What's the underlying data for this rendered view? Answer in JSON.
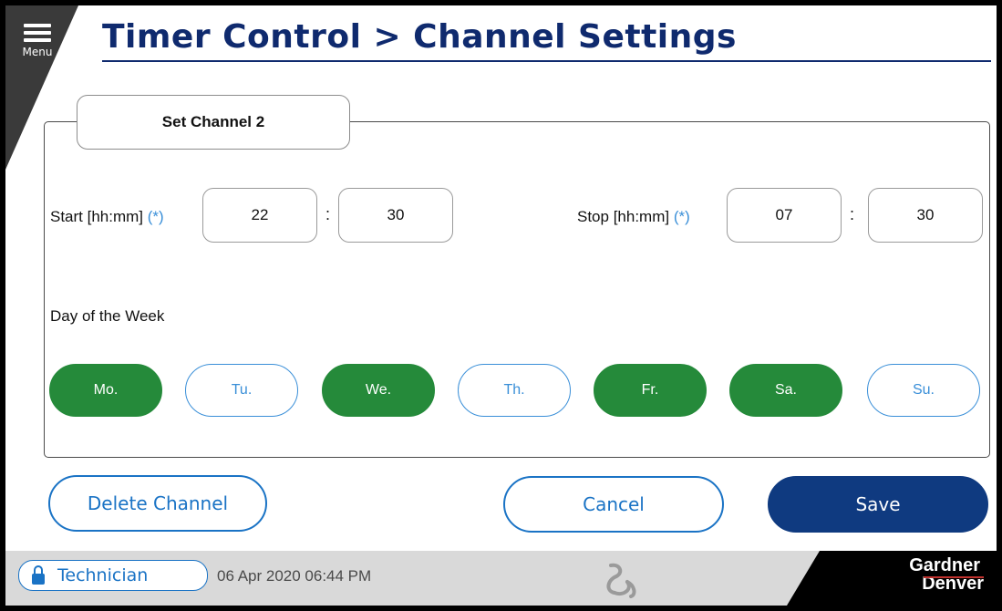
{
  "header": {
    "menu_label": "Menu",
    "title": "Timer Control > Channel Settings"
  },
  "panel": {
    "tab_label": "Set Channel 2",
    "start_label": "Start [hh:mm]",
    "stop_label": "Stop [hh:mm]",
    "required_marker": "(*)",
    "colon": ":",
    "start_hours": "22",
    "start_minutes": "30",
    "stop_hours": "07",
    "stop_minutes": "30",
    "days_label": "Day of the Week",
    "days": [
      {
        "label": "Mo.",
        "active": true
      },
      {
        "label": "Tu.",
        "active": false
      },
      {
        "label": "We.",
        "active": true
      },
      {
        "label": "Th.",
        "active": false
      },
      {
        "label": "Fr.",
        "active": true
      },
      {
        "label": "Sa.",
        "active": true
      },
      {
        "label": "Su.",
        "active": false
      }
    ]
  },
  "actions": {
    "delete_label": "Delete Channel",
    "cancel_label": "Cancel",
    "save_label": "Save"
  },
  "status_bar": {
    "role": "Technician",
    "datetime": "06 Apr 2020  06:44 PM",
    "brand_line1": "Gardner",
    "brand_line2": "Denver"
  },
  "colors": {
    "title": "#0f2a6e",
    "accent": "#1a73c5",
    "active_day": "#258a3a",
    "save_button": "#0f3a80"
  },
  "icons": {
    "menu": "hamburger-icon",
    "lock": "lock-icon",
    "brand_mark": "gardner-denver-logo-mark"
  }
}
